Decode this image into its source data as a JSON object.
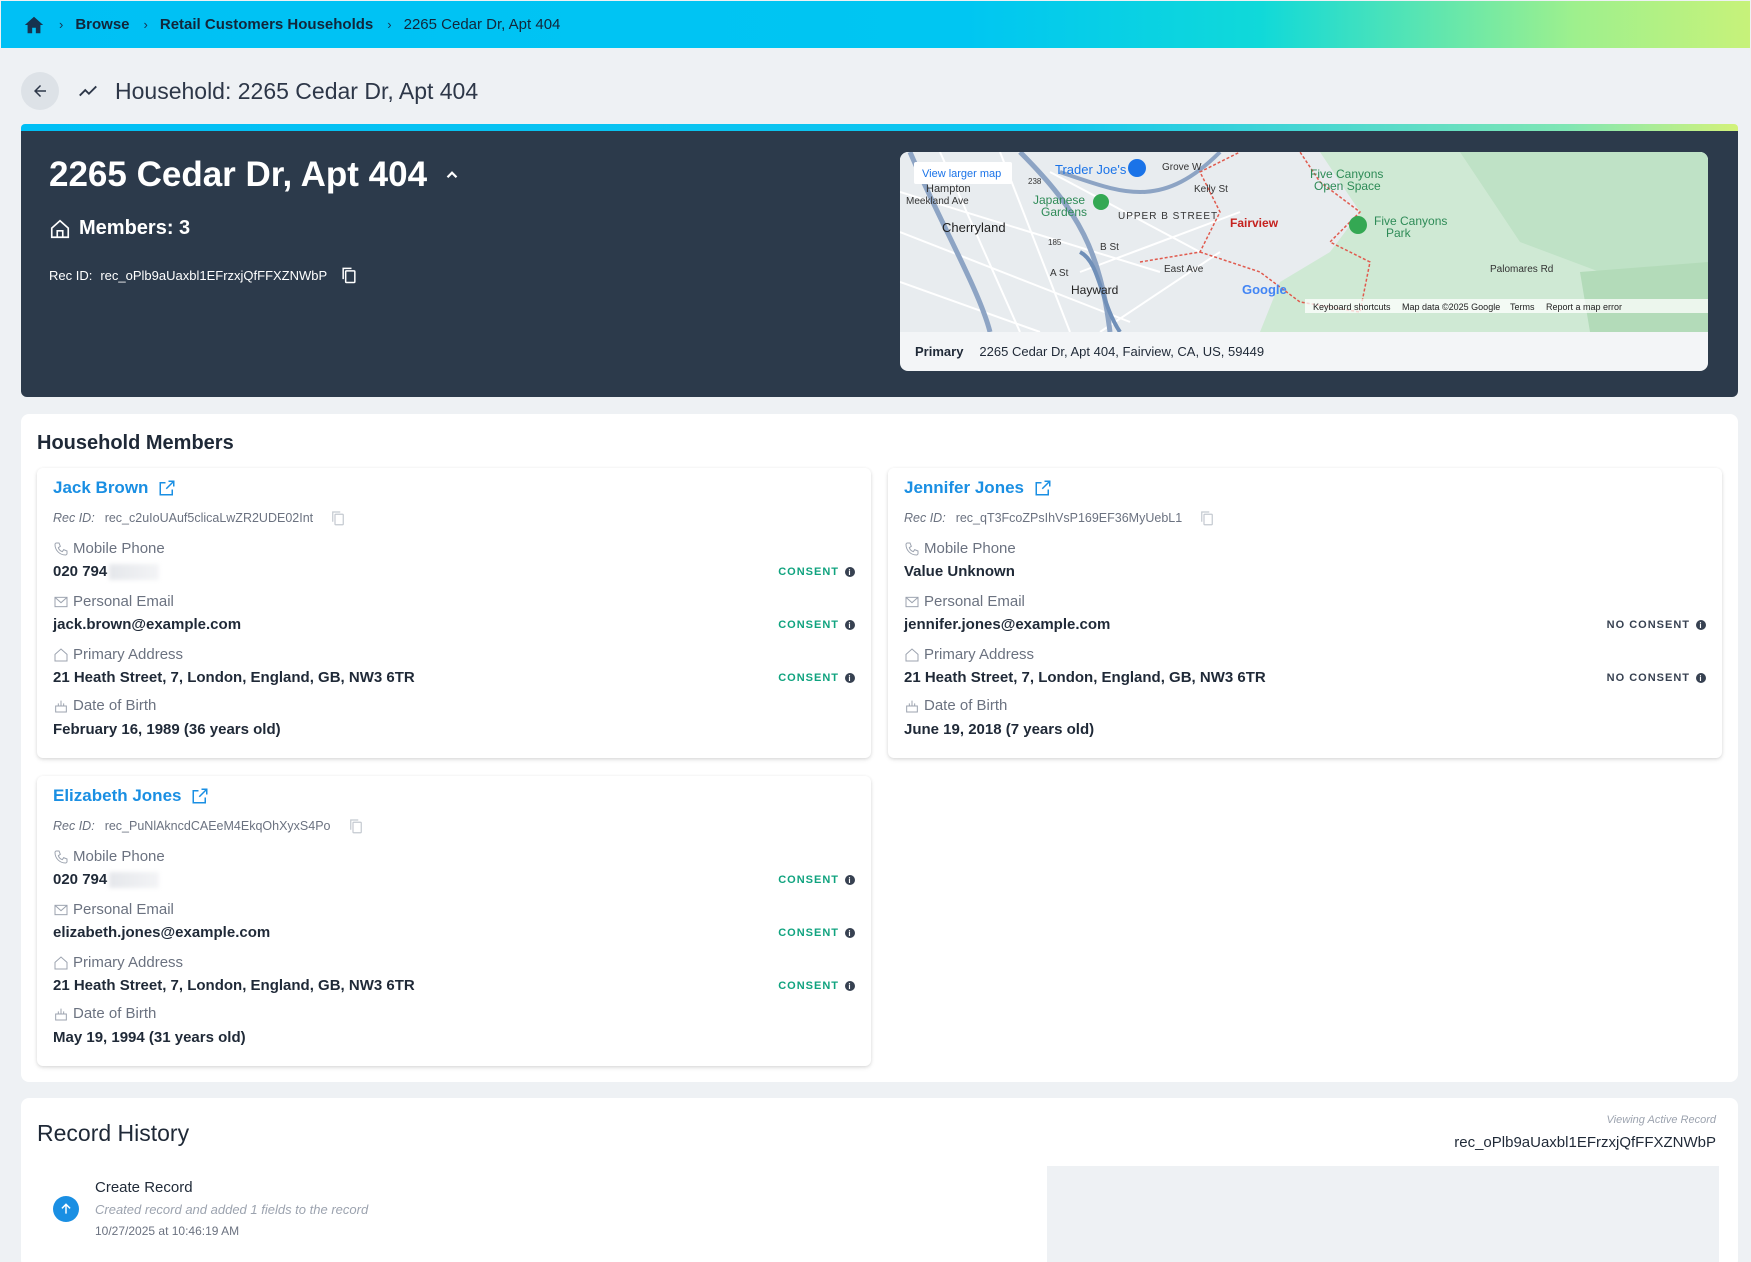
{
  "breadcrumb": {
    "items": [
      "Browse",
      "Retail Customers Households"
    ],
    "current": "2265 Cedar Dr, Apt 404"
  },
  "page": {
    "title": "Household: 2265 Cedar Dr, Apt 404"
  },
  "hero": {
    "address": "2265 Cedar Dr, Apt 404",
    "members_label": "Members: 3",
    "rec_label": "Rec ID:",
    "rec_id": "rec_oPlb9aUaxbl1EFrzxjQfFFXZNWbP"
  },
  "map": {
    "view_larger": "View larger map",
    "labels": {
      "trader_joes": "Trader Joe's",
      "japanese_gardens_1": "Japanese",
      "japanese_gardens_2": "Gardens",
      "cherryland": "Cherryland",
      "hampton": "Hampton",
      "upper_b_street": "UPPER B STREET",
      "fairview": "Fairview",
      "five_canyons_open_1": "Five Canyons",
      "five_canyons_open_2": "Open Space",
      "five_canyons_park_1": "Five Canyons",
      "five_canyons_park_2": "Park",
      "kelly_st": "Kelly St",
      "east_ave": "East Ave",
      "hayward": "Hayward",
      "b_st": "B St",
      "a_st": "A St",
      "grove_way": "Grove W",
      "palomares_rd": "Palomares Rd",
      "meekland_ave": "Meekland Ave",
      "route_238": "238",
      "route_185": "185",
      "google": "Google",
      "keyboard_shortcuts": "Keyboard shortcuts",
      "map_data": "Map data ©2025 Google",
      "terms": "Terms",
      "report": "Report a map error"
    },
    "primary_label": "Primary",
    "primary_address": "2265 Cedar Dr, Apt 404, Fairview, CA, US, 59449"
  },
  "members_section": {
    "title": "Household Members",
    "field_labels": {
      "mobile": "Mobile Phone",
      "email": "Personal Email",
      "address": "Primary Address",
      "dob": "Date of Birth"
    },
    "rec_label": "Rec ID:",
    "members": [
      {
        "name": "Jack Brown",
        "rec_id": "rec_c2uIoUAuf5clicaLwZR2UDE02Int",
        "mobile": "020 794",
        "mobile_consent": "CONSENT",
        "email": "jack.brown@example.com",
        "email_consent": "CONSENT",
        "address": "21 Heath Street, 7, London, England, GB, NW3 6TR",
        "address_consent": "CONSENT",
        "dob": "February 16, 1989 (36 years old)"
      },
      {
        "name": "Jennifer Jones",
        "rec_id": "rec_qT3FcoZPsIhVsP169EF36MyUebL1",
        "mobile": "Value Unknown",
        "mobile_consent": "",
        "email": "jennifer.jones@example.com",
        "email_consent": "NO CONSENT",
        "address": "21 Heath Street, 7, London, England, GB, NW3 6TR",
        "address_consent": "NO CONSENT",
        "dob": "June 19, 2018 (7 years old)"
      },
      {
        "name": "Elizabeth Jones",
        "rec_id": "rec_PuNlAkncdCAEeM4EkqOhXyxS4Po",
        "mobile": "020 794",
        "mobile_consent": "CONSENT",
        "email": "elizabeth.jones@example.com",
        "email_consent": "CONSENT",
        "address": "21 Heath Street, 7, London, England, GB, NW3 6TR",
        "address_consent": "CONSENT",
        "dob": "May 19, 1994 (31 years old)"
      }
    ]
  },
  "history": {
    "title": "Record History",
    "viewing_label": "Viewing Active Record",
    "viewing_id": "rec_oPlb9aUaxbl1EFrzxjQfFFXZNWbP",
    "entries": [
      {
        "action": "Create Record",
        "description": "Created record and added 1 fields to the record",
        "timestamp": "10/27/2025 at 10:46:19 AM"
      }
    ]
  },
  "colors": {
    "accent": "#1a8fe3",
    "hero_bg": "#2c3a4b",
    "consent_green": "#10a37f",
    "page_bg": "#eef1f4"
  },
  "icons": [
    "home-icon",
    "back-arrow-icon",
    "trend-icon",
    "chevron-up-icon",
    "house-icon",
    "copy-icon",
    "external-link-icon",
    "phone-icon",
    "mail-icon",
    "cake-icon",
    "info-icon",
    "arrow-up-icon"
  ]
}
